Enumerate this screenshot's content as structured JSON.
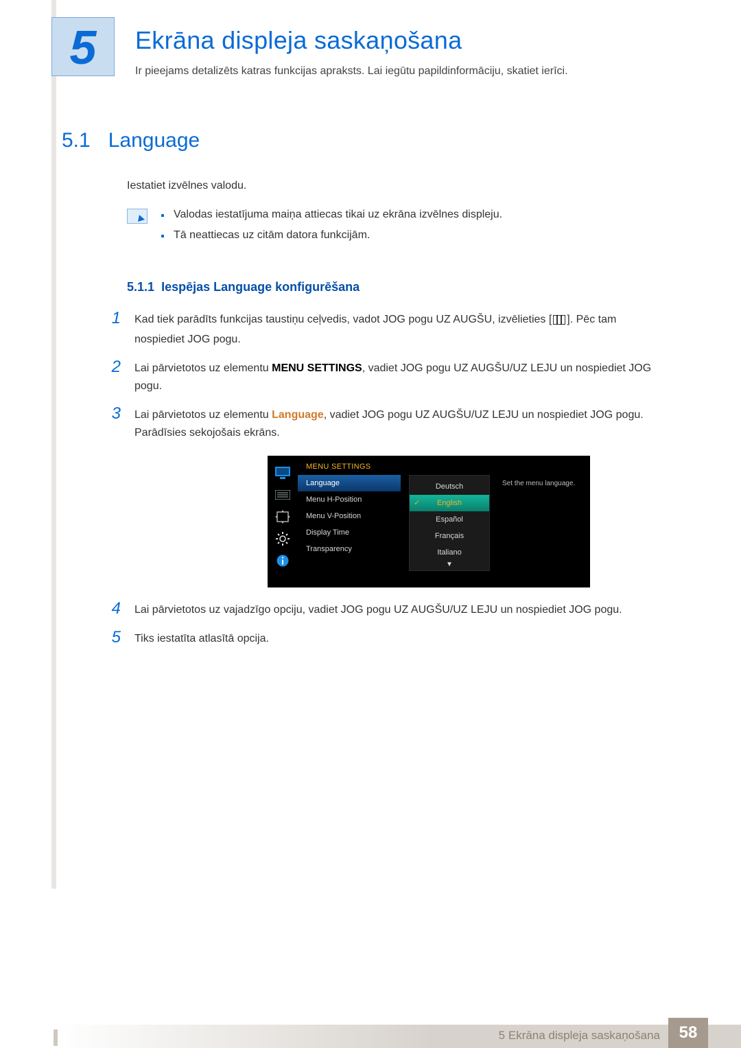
{
  "chapter": {
    "num": "5",
    "title": "Ekrāna displeja saskaņošana",
    "intro": "Ir pieejams detalizēts katras funkcijas apraksts. Lai iegūtu papildinformāciju, skatiet ierīci."
  },
  "section": {
    "num": "5.1",
    "title": "Language",
    "intro": "Iestatiet izvēlnes valodu.",
    "notes": [
      "Valodas iestatījuma maiņa attiecas tikai uz ekrāna izvēlnes displeju.",
      "Tā neattiecas uz citām datora funkcijām."
    ]
  },
  "subsection": {
    "num": "5.1.1",
    "title": "Iespējas Language konfigurēšana"
  },
  "steps": {
    "s1a": "Kad tiek parādīts funkcijas taustiņu ceļvedis, vadot JOG pogu UZ AUGŠU, izvēlieties [",
    "s1b": "]. Pēc tam nospiediet JOG pogu.",
    "s2a": "Lai pārvietotos uz elementu ",
    "s2_hl": "MENU SETTINGS",
    "s2b": ", vadiet JOG pogu UZ AUGŠU/UZ LEJU un nospiediet JOG pogu.",
    "s3a": "Lai pārvietotos uz elementu ",
    "s3_hl": "Language",
    "s3b": ", vadiet JOG pogu UZ AUGŠU/UZ LEJU un nospiediet JOG pogu. Parādīsies sekojošais ekrāns.",
    "s4": "Lai pārvietotos uz vajadzīgo opciju, vadiet JOG pogu UZ AUGŠU/UZ LEJU un nospiediet JOG pogu.",
    "s5": "Tiks iestatīta atlasītā opcija.",
    "nums": {
      "n1": "1",
      "n2": "2",
      "n3": "3",
      "n4": "4",
      "n5": "5"
    }
  },
  "osd": {
    "title": "MENU SETTINGS",
    "left": [
      "Language",
      "Menu H-Position",
      "Menu V-Position",
      "Display Time",
      "Transparency"
    ],
    "langs": [
      "Deutsch",
      "English",
      "Español",
      "Français",
      "Italiano"
    ],
    "help": "Set the menu language."
  },
  "footer": {
    "text": "5 Ekrāna displeja saskaņošana",
    "page": "58"
  }
}
